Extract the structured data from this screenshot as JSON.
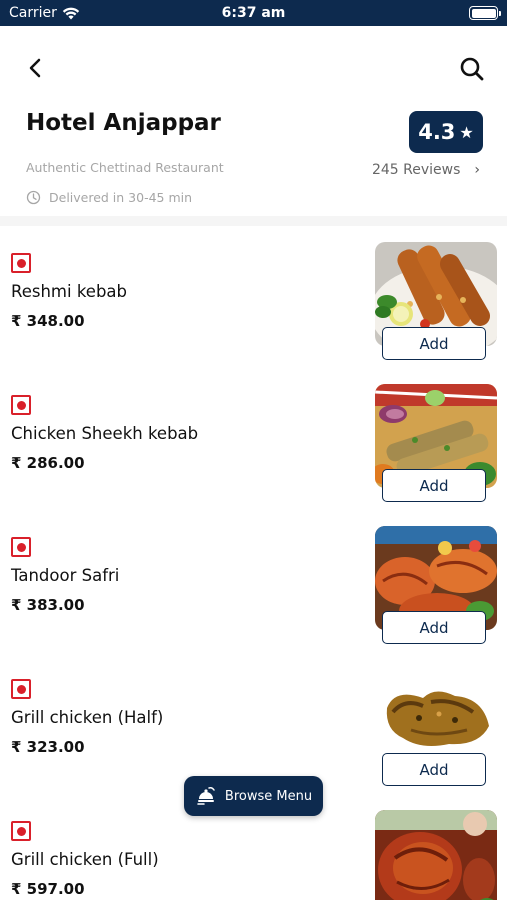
{
  "status_bar": {
    "carrier": "Carrier",
    "time": "6:37 am"
  },
  "restaurant": {
    "name": "Hotel Anjappar",
    "tagline": "Authentic Chettinad Restaurant",
    "delivery_time": "Delivered in 30-45 min",
    "rating": "4.3",
    "reviews": "245 Reviews"
  },
  "currency_symbol": "₹",
  "add_label": "Add",
  "browse_menu_label": "Browse Menu",
  "menu_items": [
    {
      "name": "Reshmi kebab",
      "price": "₹ 348.00"
    },
    {
      "name": "Chicken Sheekh kebab",
      "price": "₹ 286.00"
    },
    {
      "name": "Tandoor Safri",
      "price": "₹ 383.00"
    },
    {
      "name": "Grill chicken (Half)",
      "price": "₹ 323.00"
    },
    {
      "name": "Grill chicken (Full)",
      "price": "₹ 597.00"
    }
  ],
  "colors": {
    "primary": "#0d2a4e",
    "nonveg": "#d9202a"
  }
}
